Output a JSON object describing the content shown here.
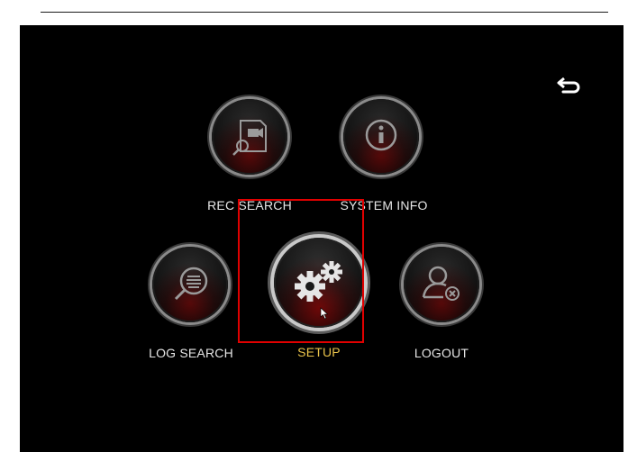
{
  "screen": {
    "menu": {
      "rec_search": {
        "label": "REC SEARCH",
        "icon": "rec-search-icon"
      },
      "system_info": {
        "label": "SYSTEM INFO",
        "icon": "info-icon"
      },
      "log_search": {
        "label": "LOG SEARCH",
        "icon": "log-search-icon"
      },
      "setup": {
        "label": "SETUP",
        "icon": "gears-icon",
        "selected": true
      },
      "logout": {
        "label": "LOGOUT",
        "icon": "logout-user-icon"
      }
    },
    "back_button": {
      "icon": "back-arrow-icon"
    },
    "colors": {
      "background": "#000000",
      "highlight": "#e00000",
      "selected_label": "#e8c24a",
      "label": "#e6e6e6"
    }
  }
}
